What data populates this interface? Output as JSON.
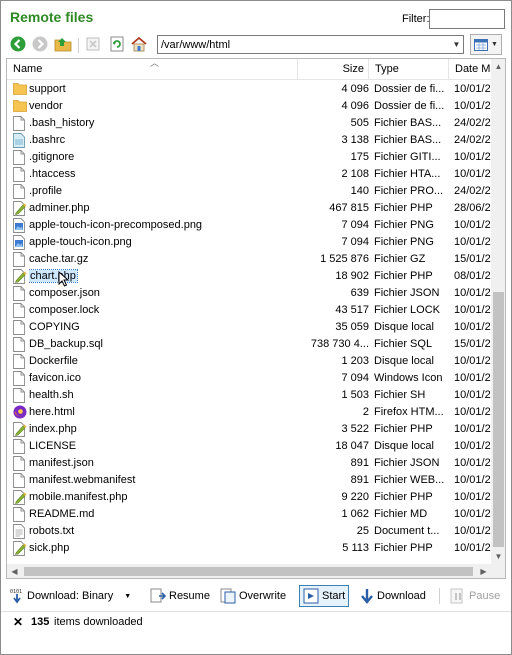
{
  "header": {
    "title": "Remote files",
    "filter_label": "Filter:",
    "filter_value": ""
  },
  "toolbar": {
    "path": "/var/www/html",
    "buttons": [
      "back-icon",
      "forward-icon",
      "parent-folder-icon",
      "delete-icon",
      "refresh-icon",
      "home-icon"
    ]
  },
  "columns": {
    "name": "Name",
    "size": "Size",
    "type": "Type",
    "date": "Date M"
  },
  "files": [
    {
      "name": "support",
      "size": "4 096",
      "type": "Dossier de fi...",
      "date": "10/01/2",
      "icon": "folder-icon"
    },
    {
      "name": "vendor",
      "size": "4 096",
      "type": "Dossier de fi...",
      "date": "10/01/2",
      "icon": "folder-icon"
    },
    {
      "name": ".bash_history",
      "size": "505",
      "type": "Fichier BAS...",
      "date": "24/02/2",
      "icon": "file-icon"
    },
    {
      "name": ".bashrc",
      "size": "3 138",
      "type": "Fichier BAS...",
      "date": "24/02/2",
      "icon": "config-file-icon"
    },
    {
      "name": ".gitignore",
      "size": "175",
      "type": "Fichier GITI...",
      "date": "10/01/2",
      "icon": "file-icon"
    },
    {
      "name": ".htaccess",
      "size": "2 108",
      "type": "Fichier HTA...",
      "date": "10/01/2",
      "icon": "file-icon"
    },
    {
      "name": ".profile",
      "size": "140",
      "type": "Fichier PRO...",
      "date": "24/02/2",
      "icon": "file-icon"
    },
    {
      "name": "adminer.php",
      "size": "467 815",
      "type": "Fichier PHP",
      "date": "28/06/2",
      "icon": "php-file-icon"
    },
    {
      "name": "apple-touch-icon-precomposed.png",
      "size": "7 094",
      "type": "Fichier PNG",
      "date": "10/01/2",
      "icon": "image-file-icon"
    },
    {
      "name": "apple-touch-icon.png",
      "size": "7 094",
      "type": "Fichier PNG",
      "date": "10/01/2",
      "icon": "image-file-icon"
    },
    {
      "name": "cache.tar.gz",
      "size": "1 525 876",
      "type": "Fichier GZ",
      "date": "15/01/2",
      "icon": "file-icon"
    },
    {
      "name": "chart.php",
      "size": "18 902",
      "type": "Fichier PHP",
      "date": "08/01/2",
      "icon": "php-file-icon",
      "selected": true
    },
    {
      "name": "composer.json",
      "size": "639",
      "type": "Fichier JSON",
      "date": "10/01/2",
      "icon": "file-icon"
    },
    {
      "name": "composer.lock",
      "size": "43 517",
      "type": "Fichier LOCK",
      "date": "10/01/2",
      "icon": "file-icon"
    },
    {
      "name": "COPYING",
      "size": "35 059",
      "type": "Disque local",
      "date": "10/01/2",
      "icon": "file-icon"
    },
    {
      "name": "DB_backup.sql",
      "size": "738 730 4...",
      "type": "Fichier SQL",
      "date": "15/01/2",
      "icon": "file-icon"
    },
    {
      "name": "Dockerfile",
      "size": "1 203",
      "type": "Disque local",
      "date": "10/01/2",
      "icon": "file-icon"
    },
    {
      "name": "favicon.ico",
      "size": "7 094",
      "type": "Windows Icon",
      "date": "10/01/2",
      "icon": "file-icon"
    },
    {
      "name": "health.sh",
      "size": "1 503",
      "type": "Fichier SH",
      "date": "10/01/2",
      "icon": "file-icon"
    },
    {
      "name": "here.html",
      "size": "2",
      "type": "Firefox HTM...",
      "date": "10/01/2",
      "icon": "firefox-html-icon"
    },
    {
      "name": "index.php",
      "size": "3 522",
      "type": "Fichier PHP",
      "date": "10/01/2",
      "icon": "php-file-icon"
    },
    {
      "name": "LICENSE",
      "size": "18 047",
      "type": "Disque local",
      "date": "10/01/2",
      "icon": "file-icon"
    },
    {
      "name": "manifest.json",
      "size": "891",
      "type": "Fichier JSON",
      "date": "10/01/2",
      "icon": "file-icon"
    },
    {
      "name": "manifest.webmanifest",
      "size": "891",
      "type": "Fichier WEB...",
      "date": "10/01/2",
      "icon": "file-icon"
    },
    {
      "name": "mobile.manifest.php",
      "size": "9 220",
      "type": "Fichier PHP",
      "date": "10/01/2",
      "icon": "php-file-icon"
    },
    {
      "name": "README.md",
      "size": "1 062",
      "type": "Fichier MD",
      "date": "10/01/2",
      "icon": "file-icon"
    },
    {
      "name": "robots.txt",
      "size": "25",
      "type": "Document t...",
      "date": "10/01/2",
      "icon": "text-file-icon"
    },
    {
      "name": "sick.php",
      "size": "5 113",
      "type": "Fichier PHP",
      "date": "10/01/2",
      "icon": "php-file-icon"
    }
  ],
  "bottom_toolbar": {
    "download_mode": "Download: Binary",
    "resume": "Resume",
    "overwrite": "Overwrite",
    "start": "Start",
    "download": "Download",
    "pause": "Pause"
  },
  "status": {
    "count": "135",
    "message": "items downloaded"
  },
  "colors": {
    "title": "#2f8a26",
    "folder": "#f5c451",
    "selection": "#cde8ff"
  }
}
